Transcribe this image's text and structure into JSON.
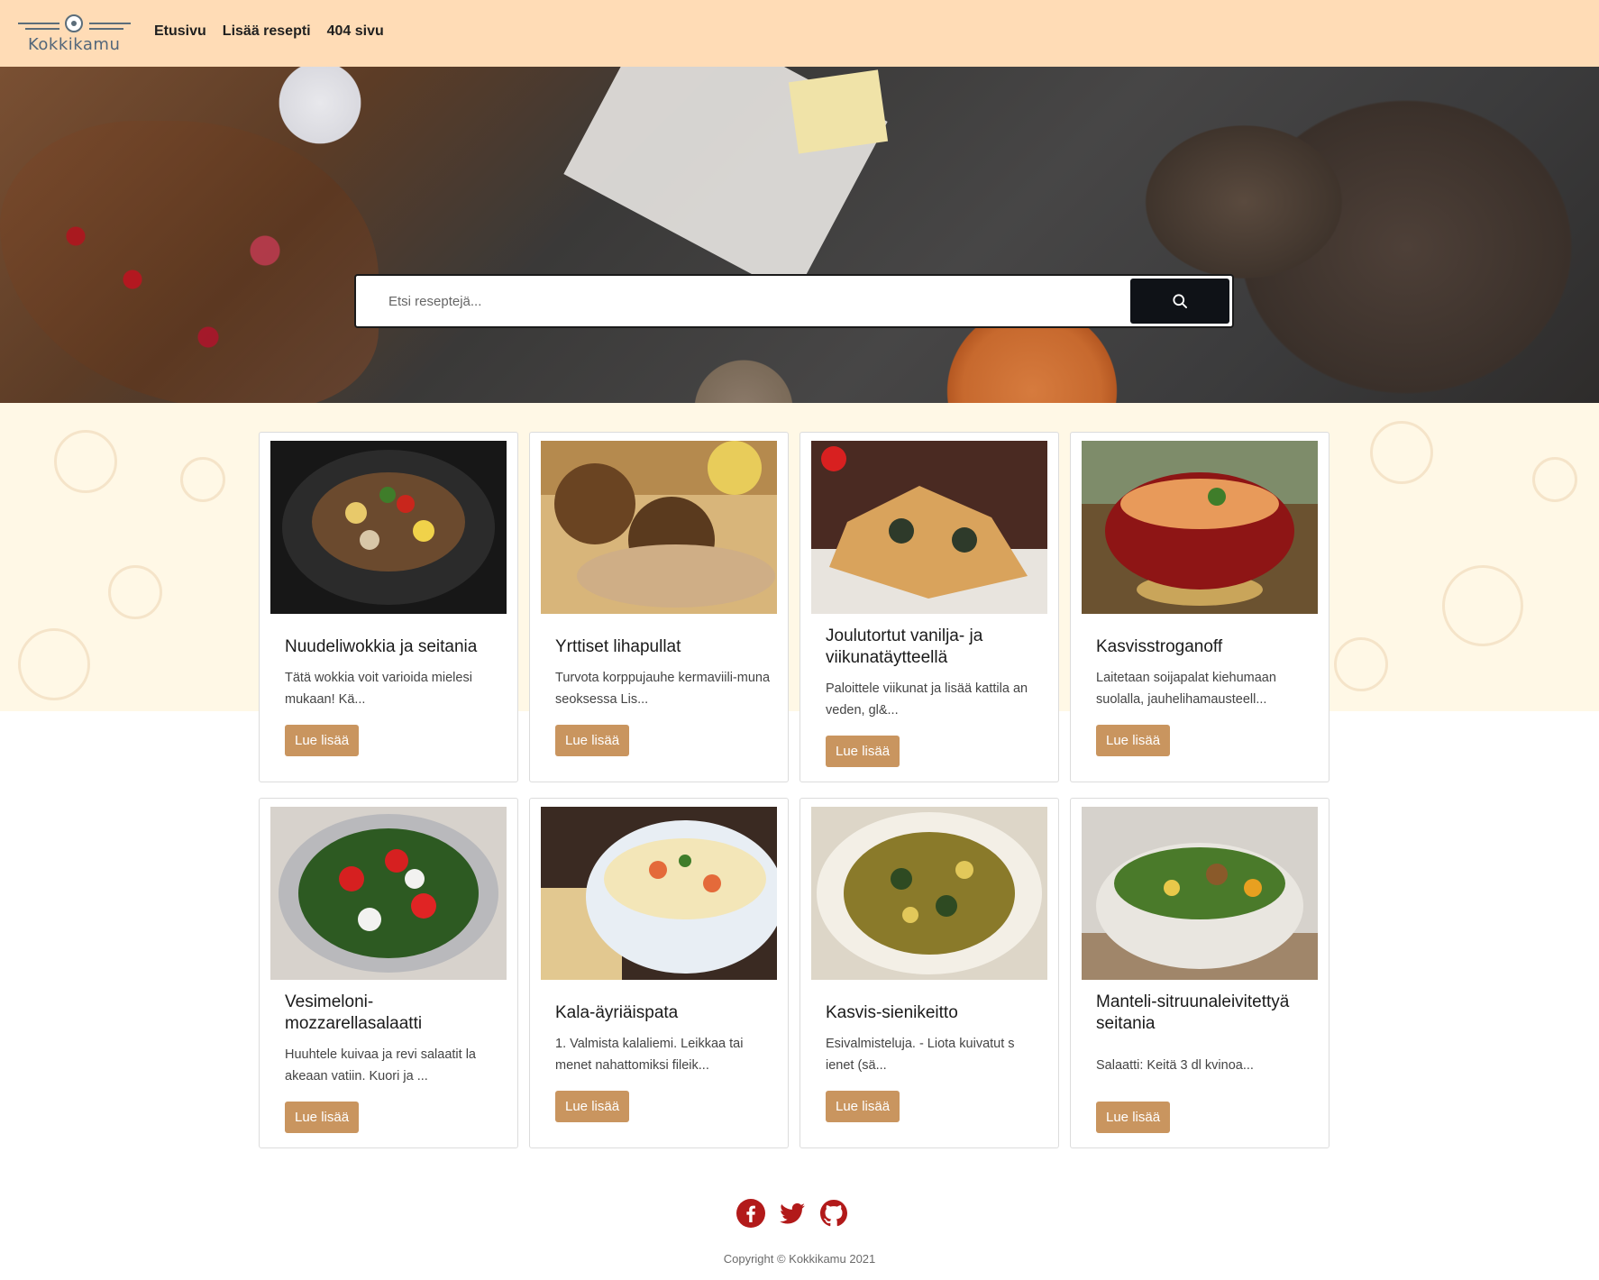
{
  "header": {
    "logo_text": "Kokkikamu",
    "nav": [
      {
        "label": "Etusivu"
      },
      {
        "label": "Lisää resepti"
      },
      {
        "label": "404 sivu"
      }
    ]
  },
  "search": {
    "placeholder": "Etsi reseptejä...",
    "button_icon": "search-icon"
  },
  "recipes": [
    {
      "title": "Nuudeliwokkia ja seitania",
      "excerpt": "Tätä wokkia voit varioida mielesi mukaan! Kä...",
      "button": "Lue lisää"
    },
    {
      "title": "Yrttiset lihapullat",
      "excerpt": "Turvota korppujauhe kermaviili-muna seoksessa Lis...",
      "button": "Lue lisää"
    },
    {
      "title": "Joulutortut vanilja- ja viikunatäytteellä",
      "excerpt": "Paloittele viikunat ja lisää kattila an veden, gl&...",
      "button": "Lue lisää"
    },
    {
      "title": "Kasvisstroganoff",
      "excerpt": "Laitetaan soijapalat kiehumaan suolalla, jauhelihamausteell...",
      "button": "Lue lisää"
    },
    {
      "title": "Vesimeloni-mozzarellasalaatti",
      "excerpt": "Huuhtele kuivaa ja revi salaatit la akeaan vatiin. Kuori ja ...",
      "button": "Lue lisää"
    },
    {
      "title": "Kala-äyriäispata",
      "excerpt": "1. Valmista kalaliemi. Leikkaa tai menet nahattomiksi fileik...",
      "button": "Lue lisää"
    },
    {
      "title": "Kasvis-sienikeitto",
      "excerpt": "Esivalmisteluja. - Liota kuivatut s ienet (sä...",
      "button": "Lue lisää"
    },
    {
      "title": "Manteli-sitruunaleivitettyä seitania",
      "excerpt": "Salaatti: Keitä 3 dl kvinoa...",
      "button": "Lue lisää"
    }
  ],
  "footer": {
    "social": [
      "facebook-icon",
      "twitter-icon",
      "github-icon"
    ],
    "copyright": "Copyright  © Kokkikamu 2021"
  },
  "colors": {
    "header_bg": "#ffdcb6",
    "button_bg": "#c9955f",
    "social": "#b21a1a"
  }
}
